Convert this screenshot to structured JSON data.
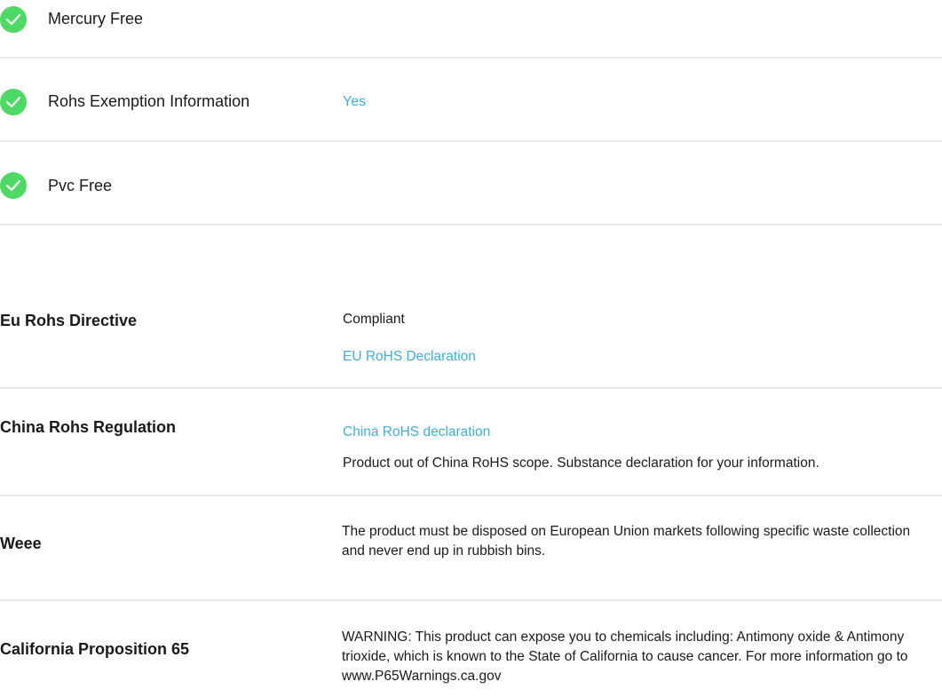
{
  "checks": [
    {
      "label": "Mercury Free",
      "value": ""
    },
    {
      "label": "Rohs Exemption Information",
      "value": "Yes"
    },
    {
      "label": "Pvc Free",
      "value": ""
    }
  ],
  "regulations": {
    "eu_rohs": {
      "label": "Eu Rohs Directive",
      "status": "Compliant",
      "link": "EU RoHS Declaration"
    },
    "china_rohs": {
      "label": "China Rohs Regulation",
      "link": "China RoHS declaration",
      "text": "Product out of China RoHS scope. Substance declaration for your information."
    },
    "weee": {
      "label": "Weee",
      "text": "The product must be disposed on European Union markets following specific waste collection and never end up in rubbish bins."
    },
    "prop65": {
      "label": "California Proposition 65",
      "text": "WARNING: This product can expose you to chemicals including: Antimony oxide & Antimony trioxide, which is known to the State of California to cause cancer. For more information go to www.P65Warnings.ca.gov"
    }
  },
  "colors": {
    "check": "#4cd964",
    "link": "#3ab0e0",
    "divider": "#e8e8e8"
  }
}
